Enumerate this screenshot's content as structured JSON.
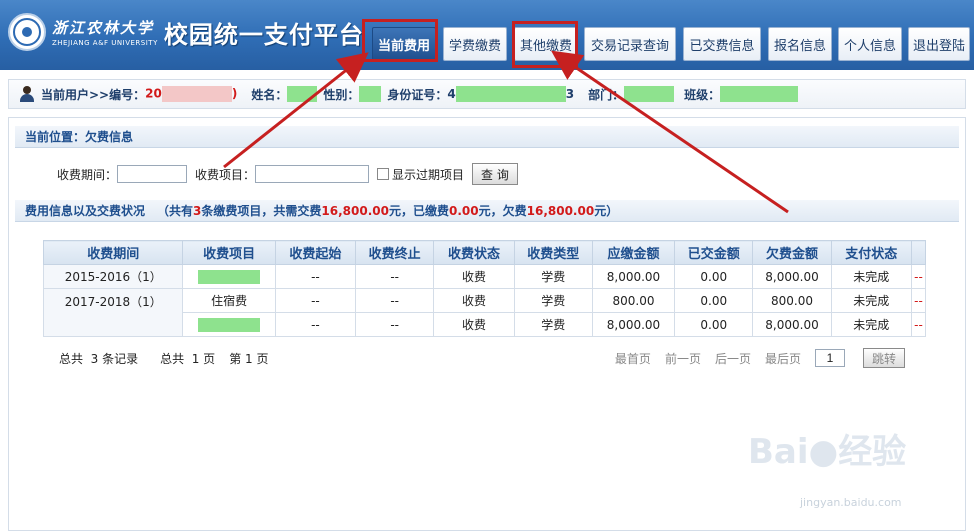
{
  "header": {
    "university_cn": "浙江农林大学",
    "university_en": "ZHEJIANG A&F UNIVERSITY",
    "platform_title": "校园统一支付平台",
    "nav": [
      "当前费用",
      "学费缴费",
      "其他缴费",
      "交易记录查询",
      "已交费信息",
      "报名信息",
      "个人信息",
      "退出登陆"
    ]
  },
  "user": {
    "prefix": "当前用户>>编号：",
    "id_value": "20",
    "id_suffix": ")",
    "name_label": "姓名：",
    "gender_label": "性别：",
    "idcard_label": "身份证号：",
    "idcard_value": "4",
    "idcard_suffix": "3",
    "dept_label": "部门：",
    "class_label": "班级："
  },
  "location": "当前位置：欠费信息",
  "search": {
    "period_label": "收费期间：",
    "item_label": "收费项目：",
    "expired_label": "显示过期项目",
    "query_button": "查 询"
  },
  "summary": {
    "prefix": "费用信息以及交费状况",
    "open": "（共有",
    "count": "3",
    "mid1": "条缴费项目，共需交费",
    "total": "16,800.00",
    "mid2": "元，已缴费",
    "paid": "0.00",
    "mid3": "元，欠费",
    "owed": "16,800.00",
    "close": "元）"
  },
  "table": {
    "headers": [
      "收费期间",
      "收费项目",
      "收费起始",
      "收费终止",
      "收费状态",
      "收费类型",
      "应缴金额",
      "已交金额",
      "欠费金额",
      "支付状态"
    ],
    "rows": [
      {
        "period": "2015-2016（1）",
        "item": "",
        "start": "--",
        "end": "--",
        "status": "收费",
        "type": "学费",
        "due": "8,000.00",
        "paid": "0.00",
        "owed": "8,000.00",
        "pay_status": "未完成",
        "extra": "--"
      },
      {
        "period": "2017-2018（1）",
        "item": "住宿费",
        "start": "--",
        "end": "--",
        "status": "收费",
        "type": "学费",
        "due": "800.00",
        "paid": "0.00",
        "owed": "800.00",
        "pay_status": "未完成",
        "extra": "--"
      },
      {
        "period": "",
        "item": "",
        "start": "--",
        "end": "--",
        "status": "收费",
        "type": "学费",
        "due": "8,000.00",
        "paid": "0.00",
        "owed": "8,000.00",
        "pay_status": "未完成",
        "extra": "--"
      }
    ]
  },
  "pager": {
    "total_records": "总共  3 条记录",
    "total_pages": "总共  1 页",
    "current_page": "第 1 页",
    "first": "最首页",
    "prev": "前一页",
    "next": "后一页",
    "last": "最后页",
    "page_value": "1",
    "jump": "跳转"
  },
  "watermark": {
    "brand": "Bai",
    "brand_cn": "经验",
    "url": "jingyan.baidu.com"
  },
  "colors": {
    "header_blue": "#2f6db5",
    "highlight_red": "#c62020",
    "amount_red": "#d21a1a"
  }
}
